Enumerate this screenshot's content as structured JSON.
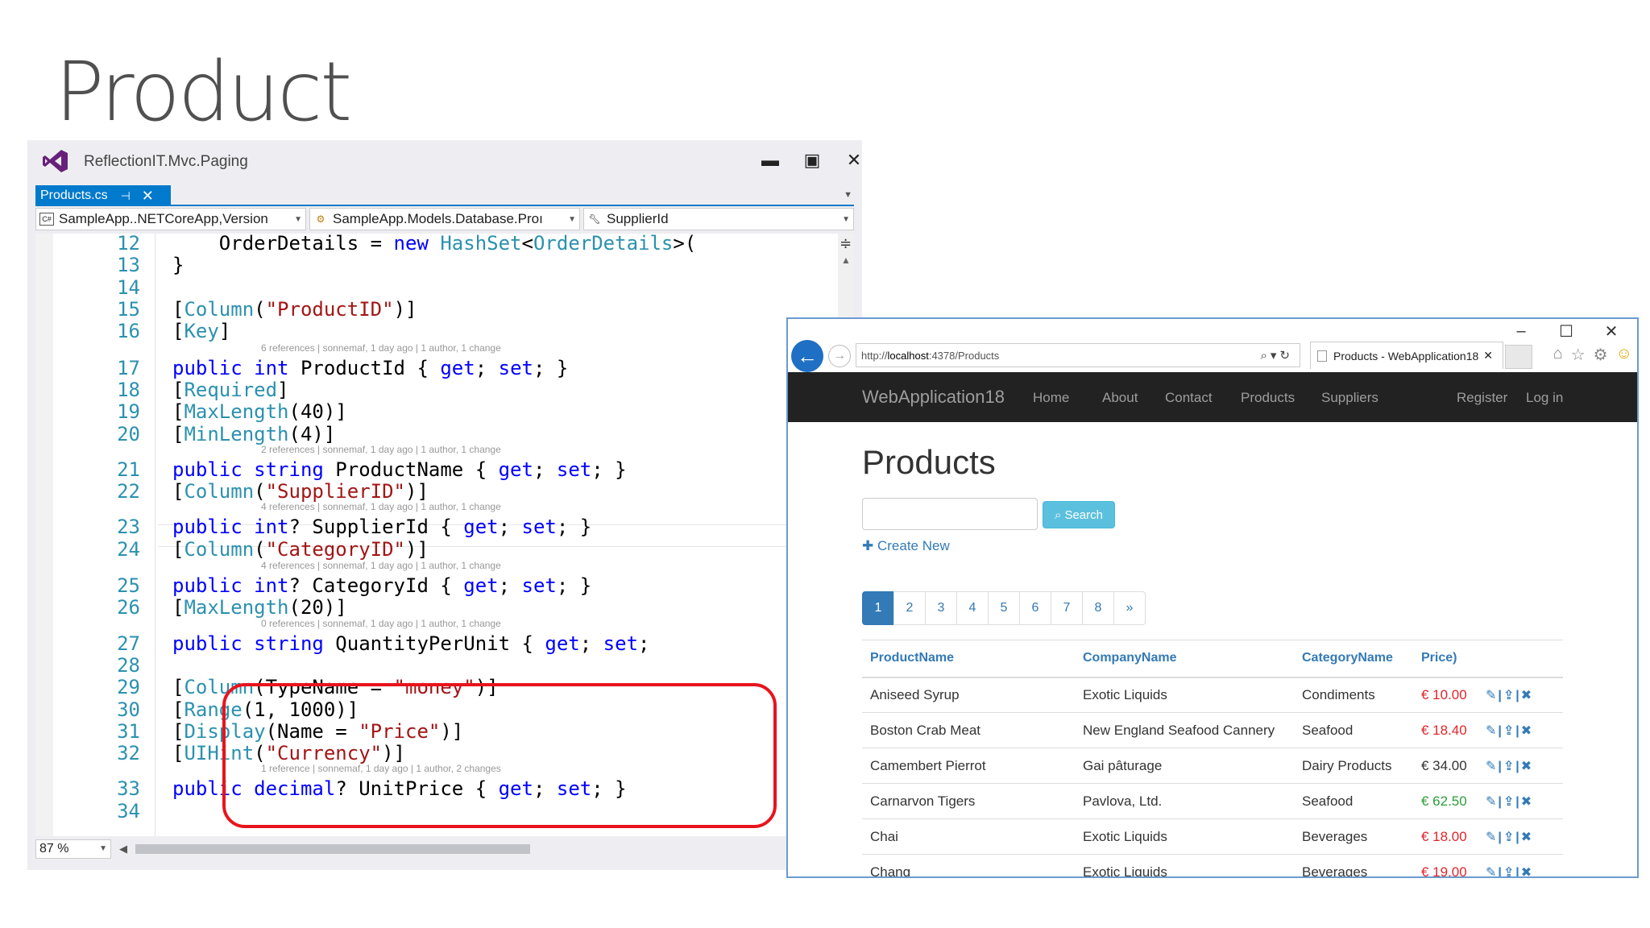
{
  "slide": {
    "title": "Product"
  },
  "vs": {
    "title": "ReflectionIT.Mvc.Paging",
    "tab": "Products.cs",
    "nav": {
      "project": "SampleApp..NETCoreApp,Version",
      "class": "SampleApp.Models.Database.Proı",
      "member": "SupplierId"
    },
    "zoom": "87 %",
    "lines": [
      {
        "n": "12",
        "code": [
          [
            "",
            "    OrderDetails = "
          ],
          [
            "kw",
            "new"
          ],
          [
            "",
            " "
          ],
          [
            "ty",
            "HashSet"
          ],
          [
            "",
            "<"
          ],
          [
            "ty",
            "OrderDetails"
          ],
          [
            "",
            ">("
          ]
        ]
      },
      {
        "n": "13",
        "code": [
          [
            "",
            "}"
          ]
        ]
      },
      {
        "n": "14",
        "code": []
      },
      {
        "n": "15",
        "code": [
          [
            "",
            "["
          ],
          [
            "ty",
            "Column"
          ],
          [
            "",
            "("
          ],
          [
            "str",
            "\"ProductID\""
          ],
          [
            "",
            ")]"
          ]
        ]
      },
      {
        "n": "16",
        "code": [
          [
            "",
            "["
          ],
          [
            "ty",
            "Key"
          ],
          [
            "",
            "]"
          ]
        ]
      },
      {
        "n": "17",
        "code": [
          [
            "kw",
            "public"
          ],
          [
            "",
            " "
          ],
          [
            "kw",
            "int"
          ],
          [
            "",
            " ProductId { "
          ],
          [
            "kw",
            "get"
          ],
          [
            "",
            "; "
          ],
          [
            "kw",
            "set"
          ],
          [
            "",
            "; }"
          ]
        ]
      },
      {
        "n": "18",
        "code": [
          [
            "",
            "["
          ],
          [
            "ty",
            "Required"
          ],
          [
            "",
            "]"
          ]
        ]
      },
      {
        "n": "19",
        "code": [
          [
            "",
            "["
          ],
          [
            "ty",
            "MaxLength"
          ],
          [
            "",
            "(40)]"
          ]
        ]
      },
      {
        "n": "20",
        "code": [
          [
            "",
            "["
          ],
          [
            "ty",
            "MinLength"
          ],
          [
            "",
            "(4)]"
          ]
        ]
      },
      {
        "n": "21",
        "code": [
          [
            "kw",
            "public"
          ],
          [
            "",
            " "
          ],
          [
            "kw",
            "string"
          ],
          [
            "",
            " ProductName { "
          ],
          [
            "kw",
            "get"
          ],
          [
            "",
            "; "
          ],
          [
            "kw",
            "set"
          ],
          [
            "",
            "; }"
          ]
        ]
      },
      {
        "n": "22",
        "code": [
          [
            "",
            "["
          ],
          [
            "ty",
            "Column"
          ],
          [
            "",
            "("
          ],
          [
            "str",
            "\"SupplierID\""
          ],
          [
            "",
            ")]"
          ]
        ]
      },
      {
        "n": "23",
        "code": [
          [
            "kw",
            "public"
          ],
          [
            "",
            " "
          ],
          [
            "kw",
            "int"
          ],
          [
            "",
            "? SupplierId { "
          ],
          [
            "kw",
            "get"
          ],
          [
            "",
            "; "
          ],
          [
            "kw",
            "set"
          ],
          [
            "",
            "; }"
          ]
        ]
      },
      {
        "n": "24",
        "code": [
          [
            "",
            "["
          ],
          [
            "ty",
            "Column"
          ],
          [
            "",
            "("
          ],
          [
            "str",
            "\"CategoryID\""
          ],
          [
            "",
            ")]"
          ]
        ]
      },
      {
        "n": "25",
        "code": [
          [
            "kw",
            "public"
          ],
          [
            "",
            " "
          ],
          [
            "kw",
            "int"
          ],
          [
            "",
            "? CategoryId { "
          ],
          [
            "kw",
            "get"
          ],
          [
            "",
            "; "
          ],
          [
            "kw",
            "set"
          ],
          [
            "",
            "; }"
          ]
        ]
      },
      {
        "n": "26",
        "code": [
          [
            "",
            "["
          ],
          [
            "ty",
            "MaxLength"
          ],
          [
            "",
            "(20)]"
          ]
        ]
      },
      {
        "n": "27",
        "code": [
          [
            "kw",
            "public"
          ],
          [
            "",
            " "
          ],
          [
            "kw",
            "string"
          ],
          [
            "",
            " QuantityPerUnit { "
          ],
          [
            "kw",
            "get"
          ],
          [
            "",
            "; "
          ],
          [
            "kw",
            "set"
          ],
          [
            "",
            ";"
          ]
        ]
      },
      {
        "n": "28",
        "code": []
      },
      {
        "n": "29",
        "code": [
          [
            "",
            "["
          ],
          [
            "ty",
            "Column"
          ],
          [
            "",
            "(TypeName = "
          ],
          [
            "str",
            "\"money\""
          ],
          [
            "",
            ")]"
          ]
        ]
      },
      {
        "n": "30",
        "code": [
          [
            "",
            "["
          ],
          [
            "ty",
            "Range"
          ],
          [
            "",
            "(1, 1000)]"
          ]
        ]
      },
      {
        "n": "31",
        "code": [
          [
            "",
            "["
          ],
          [
            "ty",
            "Display"
          ],
          [
            "",
            "(Name = "
          ],
          [
            "str",
            "\"Price\""
          ],
          [
            "",
            ")]"
          ]
        ]
      },
      {
        "n": "32",
        "code": [
          [
            "",
            "["
          ],
          [
            "ty",
            "UIHint"
          ],
          [
            "",
            "("
          ],
          [
            "str",
            "\"Currency\""
          ],
          [
            "",
            ")]"
          ]
        ]
      },
      {
        "n": "33",
        "code": [
          [
            "kw",
            "public"
          ],
          [
            "",
            " "
          ],
          [
            "kw",
            "decimal"
          ],
          [
            "",
            "? UnitPrice { "
          ],
          [
            "kw",
            "get"
          ],
          [
            "",
            "; "
          ],
          [
            "kw",
            "set"
          ],
          [
            "",
            "; }"
          ]
        ]
      },
      {
        "n": "34",
        "code": []
      }
    ],
    "lens": [
      {
        "before": "17",
        "text": "6 references | sonnemaf, 1 day ago | 1 author, 1 change"
      },
      {
        "before": "21",
        "text": "2 references | sonnemaf, 1 day ago | 1 author, 1 change"
      },
      {
        "before": "23",
        "text": "4 references | sonnemaf, 1 day ago | 1 author, 1 change"
      },
      {
        "before": "25",
        "text": "4 references | sonnemaf, 1 day ago | 1 author, 1 change"
      },
      {
        "before": "27",
        "text": "0 references | sonnemaf, 1 day ago | 1 author, 1 change"
      },
      {
        "before": "33",
        "text": "1 reference | sonnemaf, 1 day ago | 1 author, 2 changes"
      }
    ]
  },
  "browser": {
    "url_prefix": "http://",
    "url_host": "localhost",
    "url_rest": ":4378/Products",
    "tab_title": "Products - WebApplication18",
    "brand": "WebApplication18",
    "nav": [
      "Home",
      "About",
      "Contact",
      "Products",
      "Suppliers"
    ],
    "nav_right": [
      "Register",
      "Log in"
    ],
    "heading": "Products",
    "search_label": "Search",
    "create_label": "Create New",
    "pages": [
      "1",
      "2",
      "3",
      "4",
      "5",
      "6",
      "7",
      "8",
      "»"
    ],
    "columns": [
      "ProductName",
      "CompanyName",
      "CategoryName",
      "Price)"
    ],
    "rows": [
      {
        "name": "Aniseed Syrup",
        "company": "Exotic Liquids",
        "category": "Condiments",
        "price": "€ 10.00",
        "color": "#e0252b"
      },
      {
        "name": "Boston Crab Meat",
        "company": "New England Seafood Cannery",
        "category": "Seafood",
        "price": "€ 18.40",
        "color": "#e0252b"
      },
      {
        "name": "Camembert Pierrot",
        "company": "Gai pâturage",
        "category": "Dairy Products",
        "price": "€ 34.00",
        "color": "#333333"
      },
      {
        "name": "Carnarvon Tigers",
        "company": "Pavlova, Ltd.",
        "category": "Seafood",
        "price": "€ 62.50",
        "color": "#2e9c3a"
      },
      {
        "name": "Chai",
        "company": "Exotic Liquids",
        "category": "Beverages",
        "price": "€ 18.00",
        "color": "#e0252b"
      },
      {
        "name": "Chang",
        "company": "Exotic Liquids",
        "category": "Beverages",
        "price": "€ 19.00",
        "color": "#e0252b"
      }
    ]
  },
  "colors": {
    "vs_accent": "#007acc",
    "highlight": "#e8141c",
    "bootstrap_primary": "#337ab7",
    "search_btn": "#5bc0de",
    "navbar": "#222222"
  }
}
